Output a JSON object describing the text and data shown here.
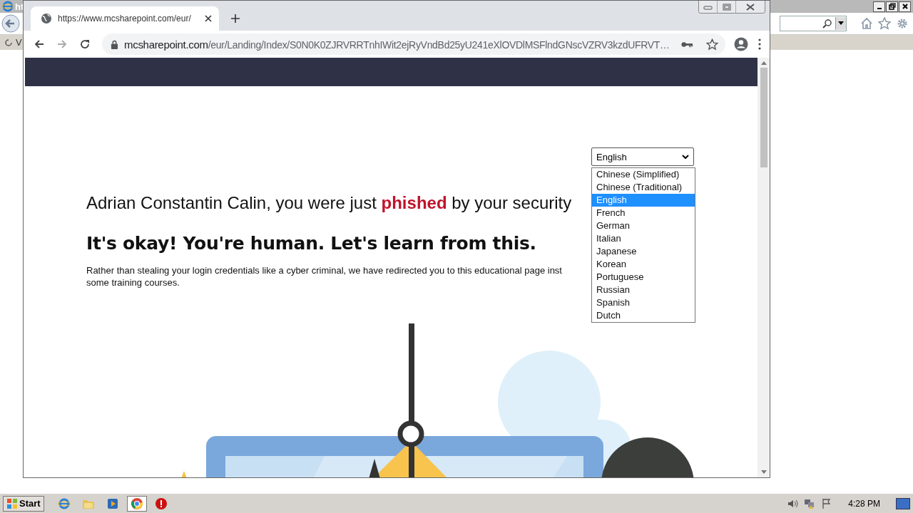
{
  "background_window": {
    "title": "ht",
    "tab_label": "V"
  },
  "browser": {
    "tab": {
      "title": "https://www.mcsharepoint.com/eur/"
    },
    "address": {
      "host": "mcsharepoint.com",
      "path": "/eur/Landing/Index/S0N0K0ZJRVRRTnhIWit2ejRyVndBd25yU241eXlOVDlMSFlndGNscVZRV3kzdUFRVT…"
    }
  },
  "page": {
    "language_select": {
      "value": "English",
      "expanded": true,
      "options": [
        {
          "label": "Chinese (Simplified)",
          "selected": false
        },
        {
          "label": "Chinese (Traditional)",
          "selected": false
        },
        {
          "label": "English",
          "selected": true
        },
        {
          "label": "French",
          "selected": false
        },
        {
          "label": "German",
          "selected": false
        },
        {
          "label": "Italian",
          "selected": false
        },
        {
          "label": "Japanese",
          "selected": false
        },
        {
          "label": "Korean",
          "selected": false
        },
        {
          "label": "Portuguese",
          "selected": false
        },
        {
          "label": "Russian",
          "selected": false
        },
        {
          "label": "Spanish",
          "selected": false
        },
        {
          "label": "Dutch",
          "selected": false
        }
      ]
    },
    "lead": "Adrian Constantin Calin, you were just **phished** by your security",
    "heading": "It's okay! You're human. Let's learn from this.",
    "paragraph_lines": [
      "Rather than stealing your login credentials like a cyber criminal, we have redirected you to this educational page inst",
      "some training courses."
    ]
  },
  "taskbar": {
    "start": "Start",
    "apps": [
      {
        "kind": "ie",
        "active": false
      },
      {
        "kind": "folder",
        "active": false
      },
      {
        "kind": "media",
        "active": false
      },
      {
        "kind": "chrome",
        "active": true
      },
      {
        "kind": "stop",
        "active": false
      }
    ],
    "clock": "4:28 PM"
  }
}
